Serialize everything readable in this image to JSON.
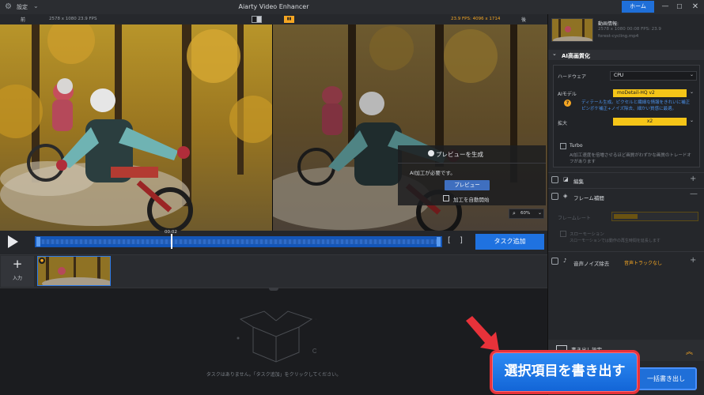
{
  "titlebar": {
    "settings_label": "設定",
    "app_title": "Aiarty Video Enhancer",
    "home_label": "ホーム"
  },
  "preview": {
    "before_label": "前",
    "source_info": "2578 x 1080  23.9 FPS",
    "output_info": "23.9 FPS: 4096 x 1714",
    "after_label": "後",
    "generate_title": "プレビューを生成",
    "processing_required": "AI加工が必要です。",
    "preview_button": "プレビュー",
    "auto_start_label": "加工を自動開始",
    "zoom_level": "60%"
  },
  "transport": {
    "time_label": "00:02",
    "mark_in": "[",
    "mark_out": "]",
    "add_task_label": "タスク追加"
  },
  "thumbnails": {
    "add_input_label": "入力"
  },
  "task_area": {
    "empty_message": "タスクはありません。「タスク追加」をクリックしてください。"
  },
  "right_panel": {
    "video_info_label": "動画情報:",
    "video_info_line1": "2578 x 1080  00:08   FPS: 23.9",
    "video_info_line2": "forest-cycling.mp4",
    "ai_section_title": "AI高画質化",
    "hardware_label": "ハードウェア",
    "hardware_value": "CPU",
    "ai_model_label": "AIモデル",
    "ai_model_value": "moDetail-HQ  v2",
    "ai_model_help_line1": "ディテール生成。ピクセルと繊細な情報をきれいに補正",
    "ai_model_help_line2": "ピンボケ補正+ノイズ除去、細かい質感に最適。",
    "scale_label": "拡大",
    "scale_value": "x2",
    "turbo_label": "Turbo",
    "turbo_desc_line1": "AI加工速度を倍増させるほど画質がわずかな画質のトレードオ",
    "turbo_desc_line2": "フがあります",
    "edit_label": "編集",
    "frame_interp_label": "フレーム補間",
    "frame_rate_label": "フレームレート",
    "slow_motion_label": "スローモーション",
    "slow_motion_desc": "スローモーションでは動作の再生時間を延長します",
    "noise_label": "音声ノイズ除去",
    "noise_track_value": "音声トラックなし",
    "export_label": "書き出し設定",
    "batch_export_label": "一括書き出し"
  },
  "annotation": {
    "export_selected_label": "選択項目を書き出す",
    "highlight_color": "#e8323a"
  }
}
